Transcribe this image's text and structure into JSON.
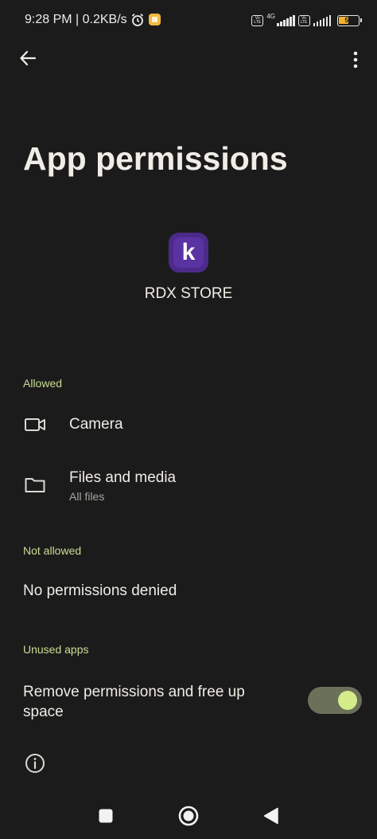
{
  "status_bar": {
    "time_speed": "9:28 PM | 0.2KB/s",
    "network_type": "4G",
    "volte_label": "Vo LTE",
    "battery_level": "54",
    "battery_percent": 54
  },
  "header": {
    "title": "App permissions",
    "back_icon": "arrow-back-icon",
    "more_icon": "more-vert-icon"
  },
  "app": {
    "name": "RDX STORE",
    "icon_letter": "k",
    "icon_color": "#4b2a8a"
  },
  "sections": {
    "allowed": {
      "header": "Allowed",
      "items": [
        {
          "title": "Camera",
          "subtitle": "",
          "icon": "camera-icon"
        },
        {
          "title": "Files and media",
          "subtitle": "All files",
          "icon": "folder-icon"
        }
      ]
    },
    "not_allowed": {
      "header": "Not allowed",
      "empty_text": "No permissions denied"
    },
    "unused_apps": {
      "header": "Unused apps",
      "remove_label": "Remove permissions and free up space",
      "toggle_on": true
    }
  },
  "colors": {
    "background": "#1b1b1b",
    "accent_header": "#c9dd95",
    "toggle_track": "#6b7058",
    "toggle_thumb": "#d4ec8a"
  },
  "nav_bar": {
    "icons": [
      "recents-square-icon",
      "home-circle-icon",
      "back-triangle-icon"
    ]
  }
}
